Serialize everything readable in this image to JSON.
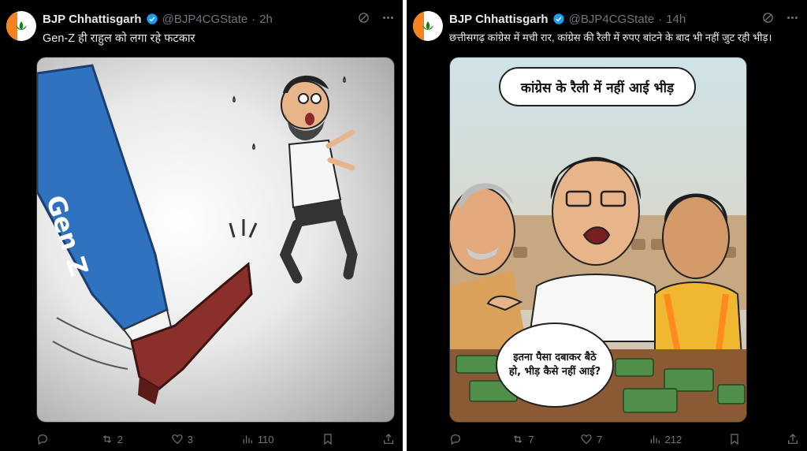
{
  "posts": [
    {
      "author": "BJP Chhattisgarh",
      "handle": "@BJP4CGState",
      "separator": "·",
      "time": "2h",
      "text": "Gen-Z ही राहुल को लगा रहे फटकार",
      "image_texts": {
        "label": "Gen Z"
      },
      "actions": {
        "replies": "",
        "reposts": "2",
        "likes": "3",
        "views": "110"
      }
    },
    {
      "author": "BJP Chhattisgarh",
      "handle": "@BJP4CGState",
      "separator": "·",
      "time": "14h",
      "text": "छत्तीसगढ़ कांग्रेस में मची रार, कांग्रेस की रैली में रुपए बांटने के बाद भी नहीं जुट रही भीड़।",
      "image_texts": {
        "caption": "कांग्रेस के रैली में नहीं आई भीड़",
        "speech": "इतना पैसा दबाकर बैठे हो, भीड़ कैसे नहीं आई?"
      },
      "actions": {
        "replies": "",
        "reposts": "7",
        "likes": "7",
        "views": "212"
      }
    }
  ],
  "colors": {
    "background": "#000000",
    "text": "#e7e9ea",
    "muted": "#71767b",
    "verified": "#1d9bf0",
    "bjp_orange": "#f58220"
  },
  "icons": [
    "grok-icon",
    "more-icon",
    "reply-icon",
    "repost-icon",
    "like-icon",
    "views-icon",
    "bookmark-icon",
    "share-icon"
  ]
}
